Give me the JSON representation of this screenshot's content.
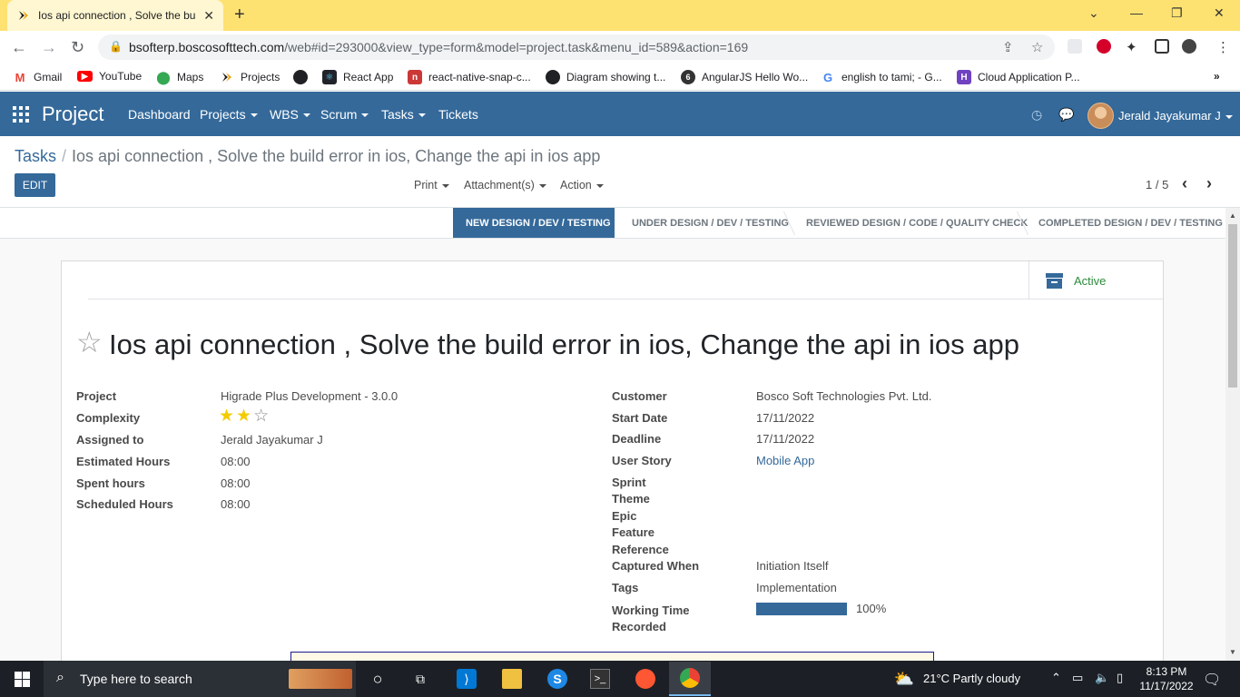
{
  "browser": {
    "tab_title": "Ios api connection , Solve the bu",
    "url_host": "bsofterp.boscosofttech.com",
    "url_path": "/web#id=293000&view_type=form&model=project.task&menu_id=589&action=169",
    "bookmarks": [
      {
        "label": "Gmail"
      },
      {
        "label": "YouTube"
      },
      {
        "label": "Maps"
      },
      {
        "label": "Projects"
      },
      {
        "label": ""
      },
      {
        "label": "React App"
      },
      {
        "label": "react-native-snap-c..."
      },
      {
        "label": "Diagram showing t..."
      },
      {
        "label": "AngularJS Hello Wo..."
      },
      {
        "label": "english to tami; - G..."
      },
      {
        "label": "Cloud Application P..."
      }
    ]
  },
  "navbar": {
    "brand": "Project",
    "menus": [
      "Dashboard",
      "Projects",
      "WBS",
      "Scrum",
      "Tasks",
      "Tickets"
    ],
    "user": "Jerald Jayakumar J",
    "color": "#34699a"
  },
  "breadcrumb": {
    "parent": "Tasks",
    "current": "Ios api connection , Solve the build error in ios, Change the api in ios app"
  },
  "actions": {
    "edit": "EDIT",
    "print": "Print",
    "attachments": "Attachment(s)",
    "action": "Action",
    "pager": "1 / 5"
  },
  "stages": [
    "NEW DESIGN / DEV / TESTING",
    "UNDER DESIGN / DEV / TESTING",
    "REVIEWED DESIGN / CODE / QUALITY CHECK",
    "COMPLETED DESIGN / DEV / TESTING"
  ],
  "active_stage": "NEW DESIGN / DEV / TESTING",
  "status_button": "Active",
  "task": {
    "title": "Ios api connection , Solve the build error in ios, Change the api in ios app",
    "left_fields": [
      {
        "label": "Project",
        "value": "Higrade Plus Development - 3.0.0"
      },
      {
        "label": "Complexity",
        "value": ""
      },
      {
        "label": "Assigned to",
        "value": "Jerald Jayakumar J"
      },
      {
        "label": "Estimated Hours",
        "value": "08:00"
      },
      {
        "label": "Spent hours",
        "value": "08:00"
      },
      {
        "label": "Scheduled Hours",
        "value": "08:00"
      }
    ],
    "complexity_stars": 2,
    "complexity_max": 3,
    "right_fields": [
      {
        "label": "Customer",
        "value": "Bosco Soft Technologies Pvt. Ltd."
      },
      {
        "label": "Start Date",
        "value": "17/11/2022"
      },
      {
        "label": "Deadline",
        "value": "17/11/2022"
      },
      {
        "label": "User Story",
        "value": "Mobile App"
      },
      {
        "label": "Sprint",
        "value": ""
      },
      {
        "label": "Theme",
        "value": ""
      },
      {
        "label": "Epic",
        "value": ""
      },
      {
        "label": "Feature",
        "value": ""
      },
      {
        "label": "Reference",
        "value": ""
      },
      {
        "label": "Captured When",
        "value": "Initiation Itself"
      },
      {
        "label": "Tags",
        "value": "Implementation"
      },
      {
        "label": "Working Time Recorded",
        "value": "100%"
      }
    ],
    "working_time_progress": 1.0
  },
  "taskbar": {
    "search_placeholder": "Type here to search",
    "weather": "21°C  Partly cloudy",
    "time": "8:13 PM",
    "date": "11/17/2022"
  }
}
